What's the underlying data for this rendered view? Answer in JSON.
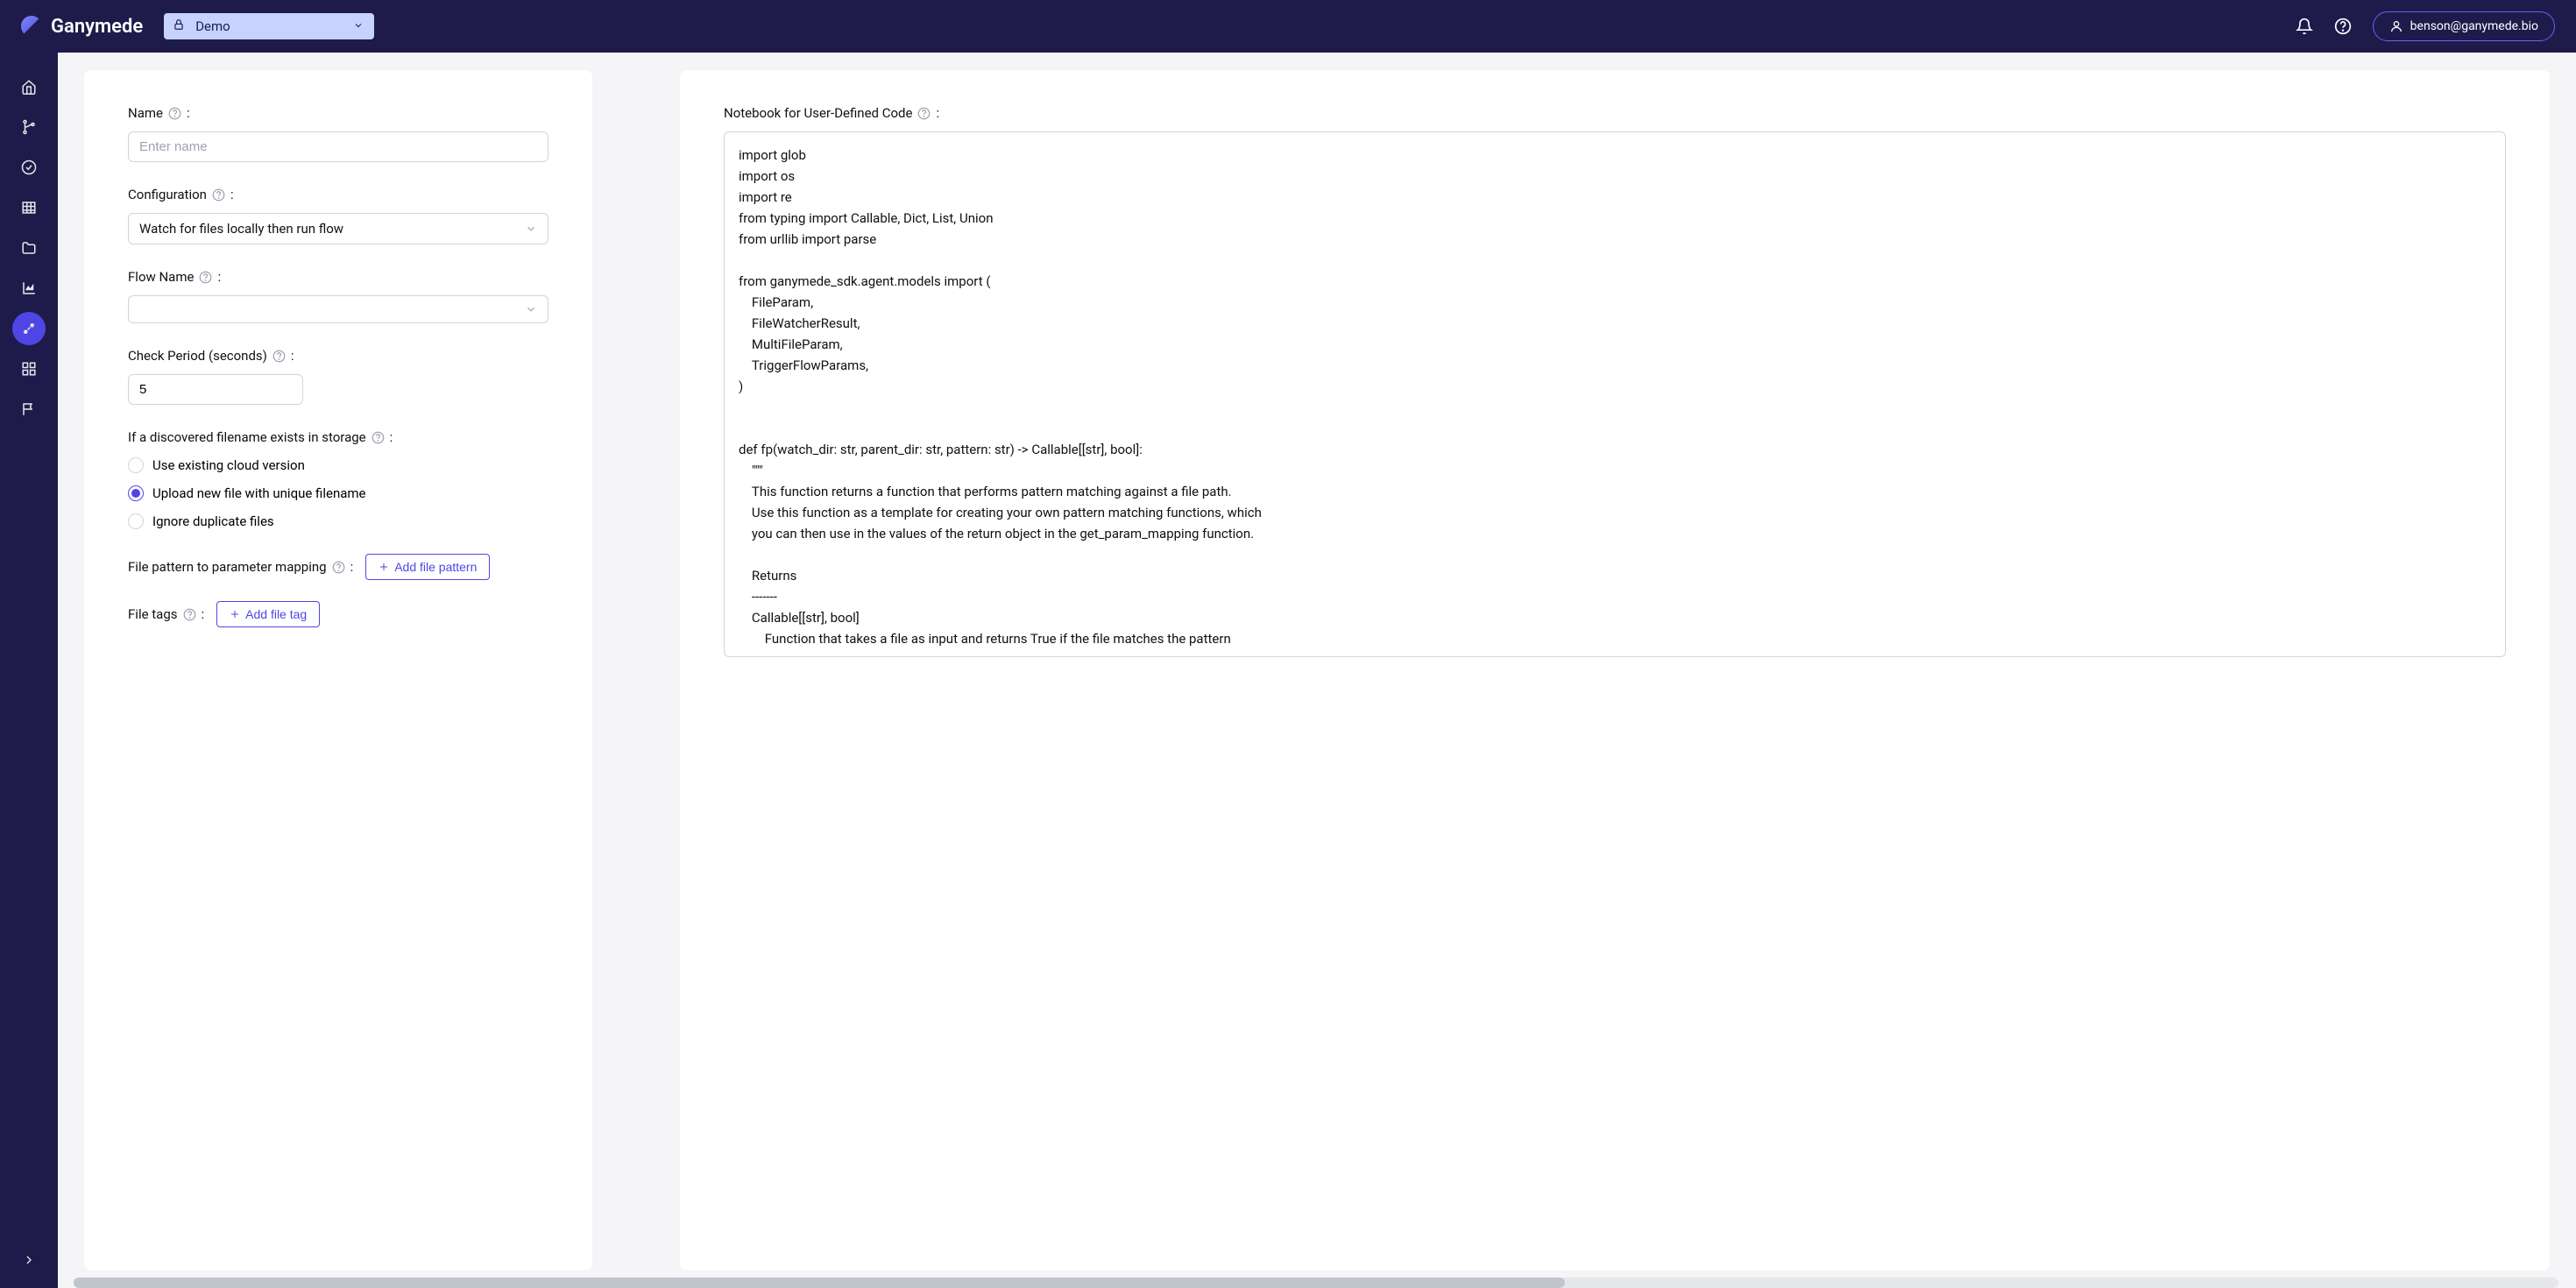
{
  "header": {
    "brand": "Ganymede",
    "environment": "Demo",
    "user_email": "benson@ganymede.bio"
  },
  "form": {
    "name": {
      "label": "Name",
      "colon": ":",
      "placeholder": "Enter name",
      "value": ""
    },
    "configuration": {
      "label": "Configuration",
      "colon": ":",
      "selected": "Watch for files locally then run flow"
    },
    "flow_name": {
      "label": "Flow Name",
      "colon": ":",
      "selected": ""
    },
    "check_period": {
      "label": "Check Period (seconds)",
      "colon": ":",
      "value": "5"
    },
    "duplicate": {
      "label": "If a discovered filename exists in storage",
      "colon": ":",
      "options": [
        "Use existing cloud version",
        "Upload new file with unique filename",
        "Ignore duplicate files"
      ],
      "selected_index": 1
    },
    "file_pattern": {
      "label": "File pattern to parameter mapping",
      "colon": ":",
      "button": "Add file pattern"
    },
    "file_tags": {
      "label": "File tags",
      "colon": ":",
      "button": "Add file tag"
    }
  },
  "notebook": {
    "label": "Notebook for User-Defined Code",
    "colon": ":",
    "code": "import glob\nimport os\nimport re\nfrom typing import Callable, Dict, List, Union\nfrom urllib import parse\n\nfrom ganymede_sdk.agent.models import (\n    FileParam,\n    FileWatcherResult,\n    MultiFileParam,\n    TriggerFlowParams,\n)\n\n\ndef fp(watch_dir: str, parent_dir: str, pattern: str) -> Callable[[str], bool]:\n    \"\"\"\n    This function returns a function that performs pattern matching against a file path.\n    Use this function as a template for creating your own pattern matching functions, which\n    you can then use in the values of the return object in the get_param_mapping function.\n\n    Returns\n    -------\n    Callable[[str], bool]\n        Function that takes a file as input and returns True if the file matches the pattern"
  }
}
